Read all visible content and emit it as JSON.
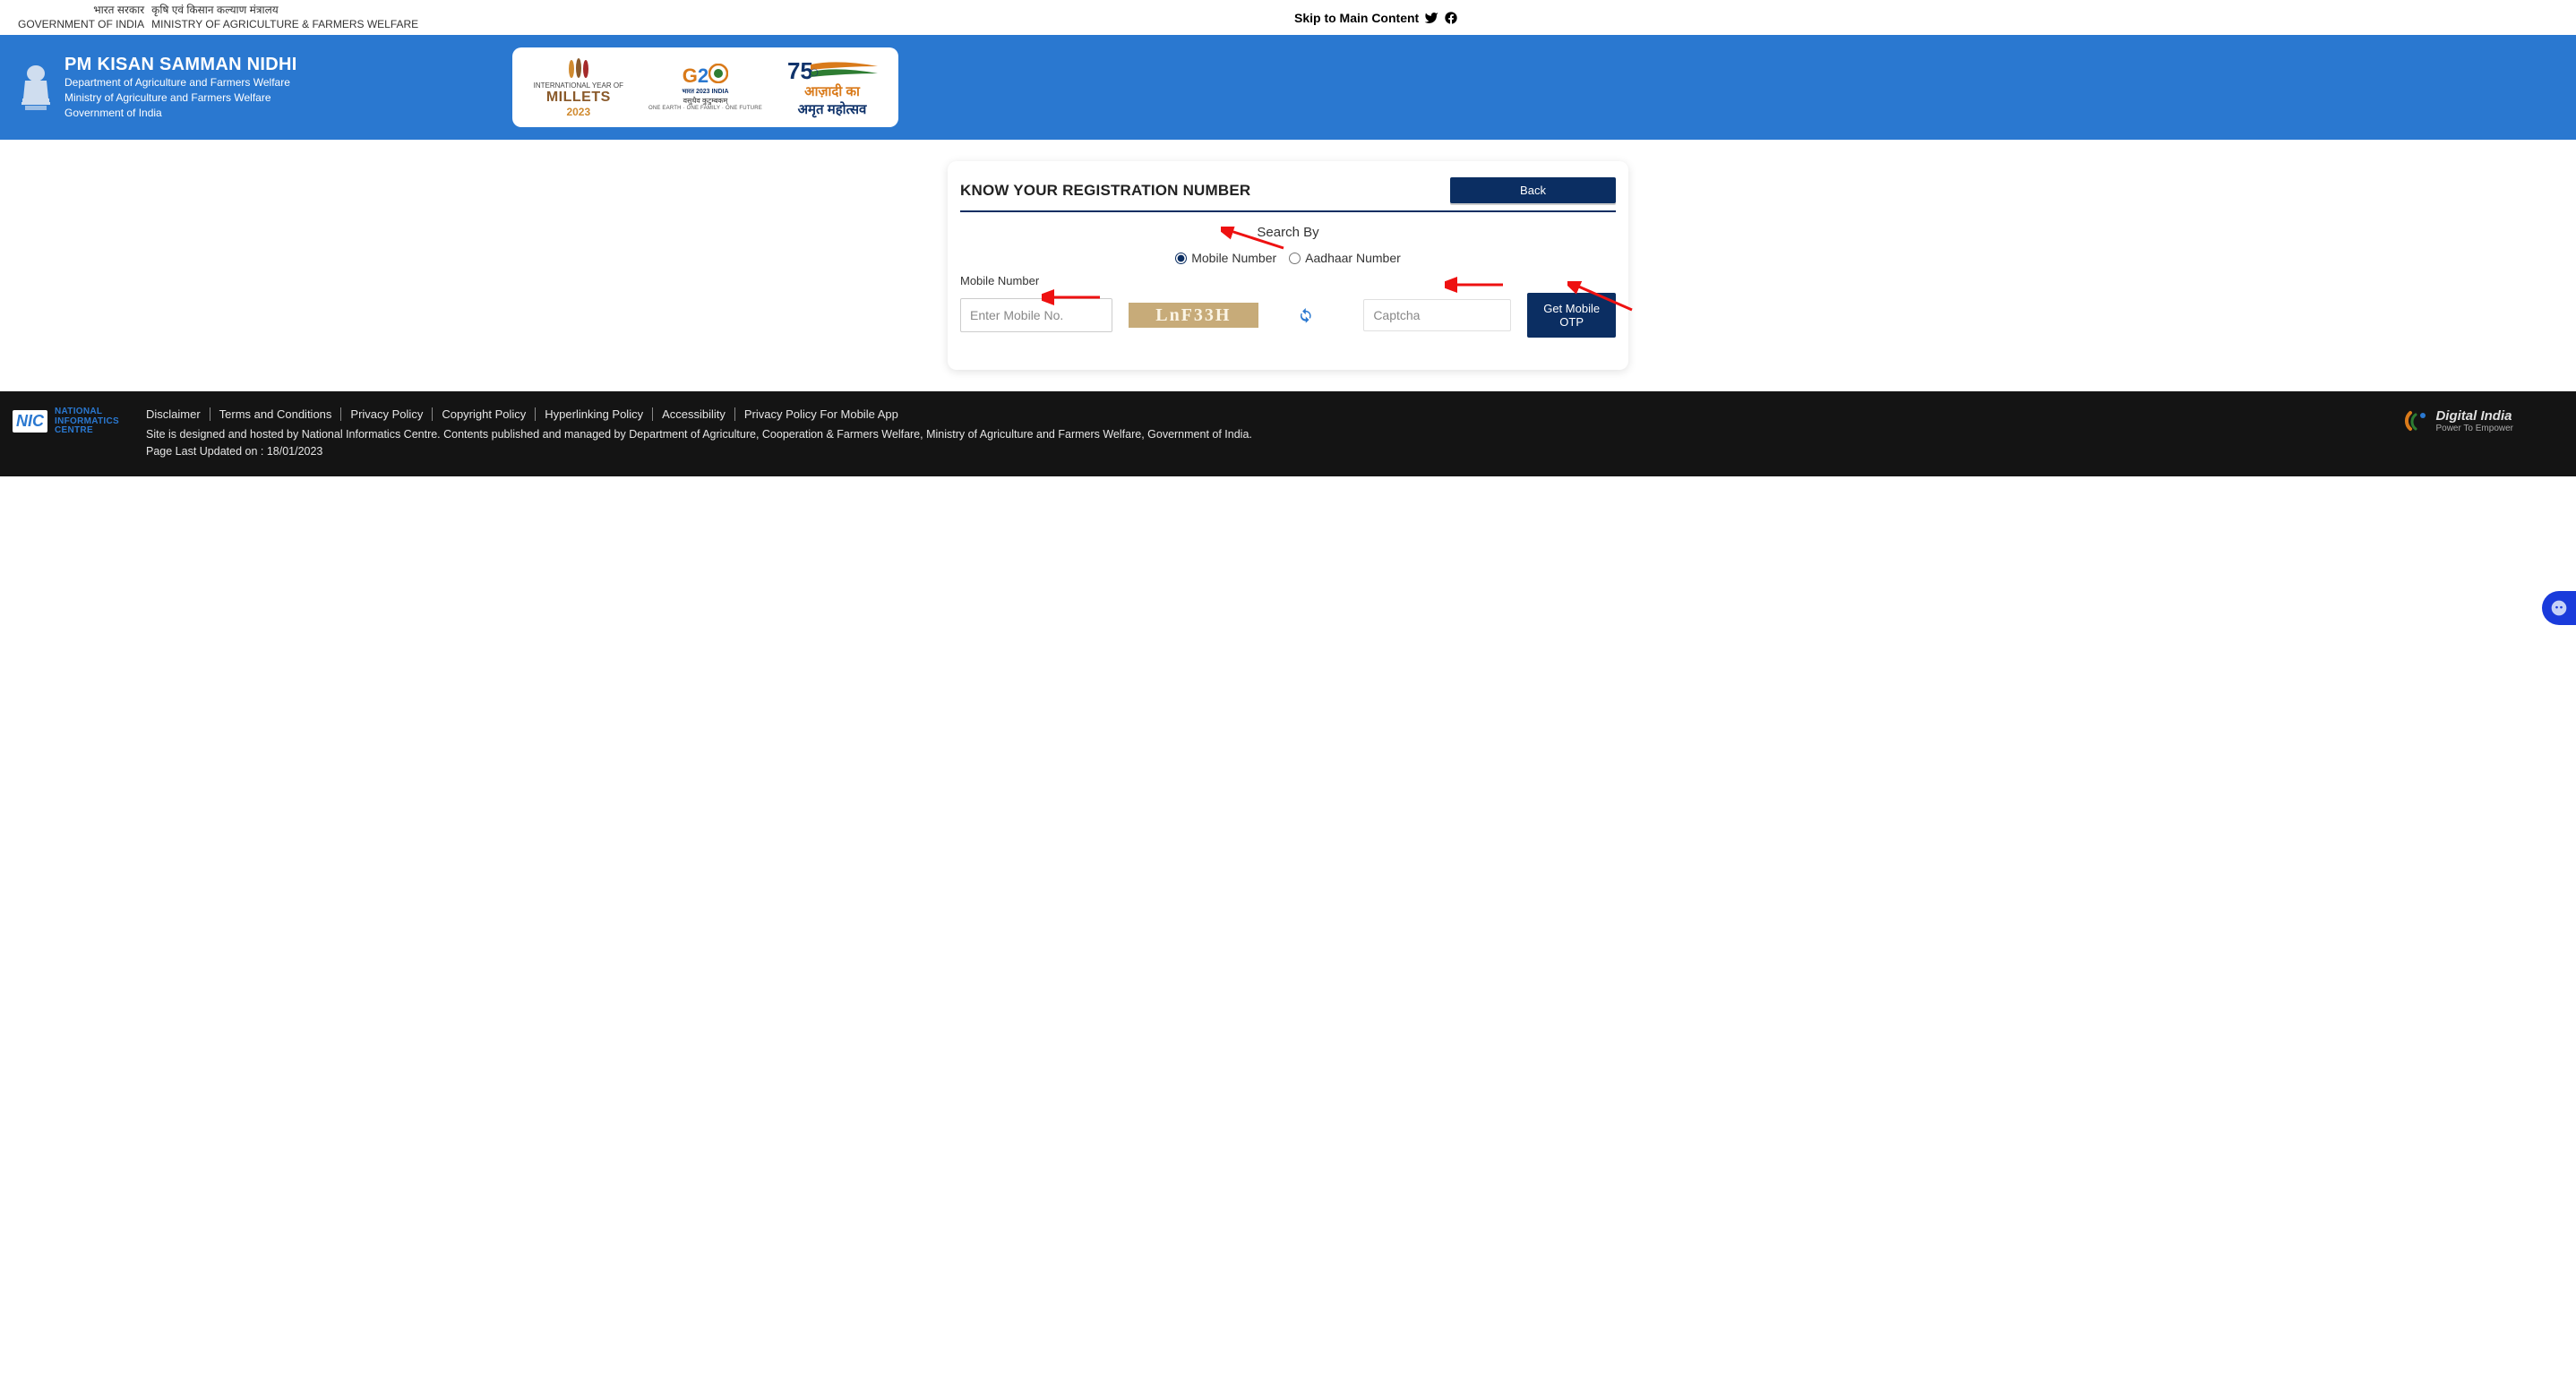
{
  "topbar": {
    "hindi1": "भारत सरकार",
    "hindi2": "कृषि एवं किसान कल्याण मंत्रालय",
    "en1": "GOVERNMENT OF INDIA",
    "en2": "MINISTRY OF AGRICULTURE & FARMERS WELFARE",
    "skip_label": "Skip to Main Content"
  },
  "header": {
    "title": "PM KISAN SAMMAN NIDHI",
    "sub1": "Department of Agriculture and Farmers Welfare",
    "sub2": "Ministry of Agriculture and Farmers Welfare",
    "sub3": "Government of India",
    "millets_small": "INTERNATIONAL YEAR OF",
    "millets_big": "MILLETS",
    "millets_year": "2023",
    "g20_tag1": "भारत 2023 INDIA",
    "g20_tag2": "वसुधैव कुटुम्बकम्",
    "g20_tag3": "ONE EARTH · ONE FAMILY · ONE FUTURE",
    "azadi_num": "75",
    "azadi_hindi1": "आज़ादी का",
    "azadi_hindi2": "अमृत महोत्सव"
  },
  "card": {
    "title": "KNOW YOUR REGISTRATION NUMBER",
    "back_label": "Back",
    "search_by_label": "Search By",
    "radio_mobile": "Mobile Number",
    "radio_aadhaar": "Aadhaar Number",
    "mobile_field_label": "Mobile Number",
    "mobile_placeholder": "Enter Mobile No.",
    "captcha_text": "LnF33H",
    "captcha_placeholder": "Captcha",
    "otp_button": "Get Mobile OTP"
  },
  "footer": {
    "links": [
      "Disclaimer",
      "Terms and Conditions",
      "Privacy Policy",
      "Copyright Policy",
      "Hyperlinking Policy",
      "Accessibility",
      "Privacy Policy For Mobile App"
    ],
    "body": "Site is designed and hosted by National Informatics Centre. Contents published and managed by Department of Agriculture, Cooperation & Farmers Welfare, Ministry of Agriculture and Farmers Welfare, Government of India.",
    "updated": "Page Last Updated on : 18/01/2023",
    "nic1": "NATIONAL",
    "nic2": "INFORMATICS",
    "nic3": "CENTRE",
    "di1": "Digital India",
    "di2": "Power To Empower"
  }
}
